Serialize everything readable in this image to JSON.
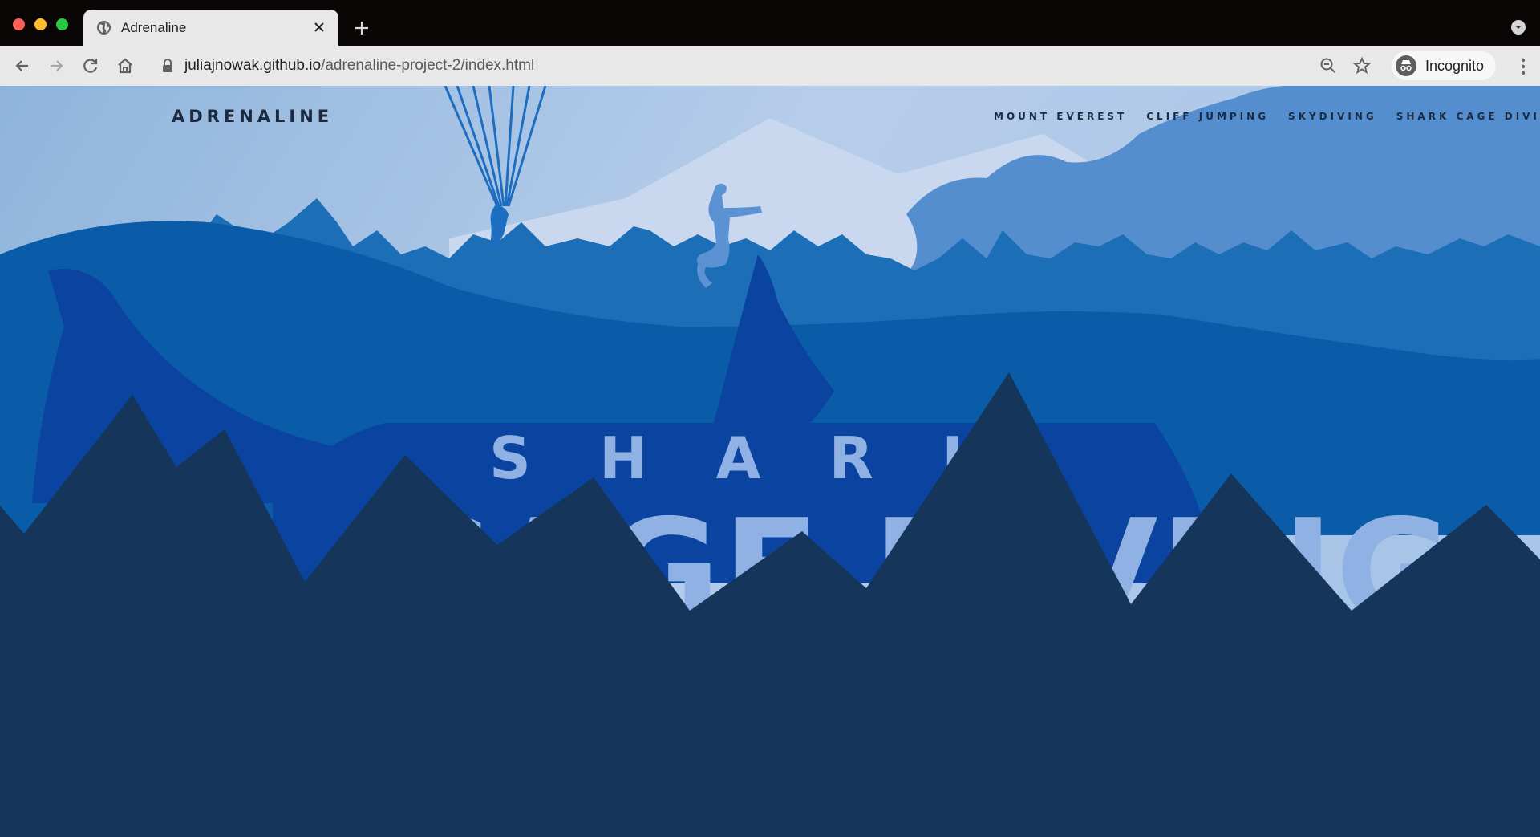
{
  "browser": {
    "tab_title": "Adrenaline",
    "url_host": "juliajnowak.github.io",
    "url_path": "/adrenaline-project-2/index.html",
    "incognito_label": "Incognito"
  },
  "site": {
    "logo": "ADRENALINE",
    "nav": [
      "MOUNT EVEREST",
      "CLIFF JUMPING",
      "SKYDIVING",
      "SHARK CAGE DIVING"
    ],
    "hero_line1": [
      "S",
      "H",
      "A",
      "R",
      "K"
    ],
    "hero_line2": "CAGE DIVING"
  },
  "colors": {
    "sky": "#aac8e8",
    "far_mountain": "#c9d8ee",
    "trees": "#1c6fb7",
    "hill": "#0b5ca8",
    "foreground": "#15365a",
    "hero_text": "#8fb1e4"
  }
}
